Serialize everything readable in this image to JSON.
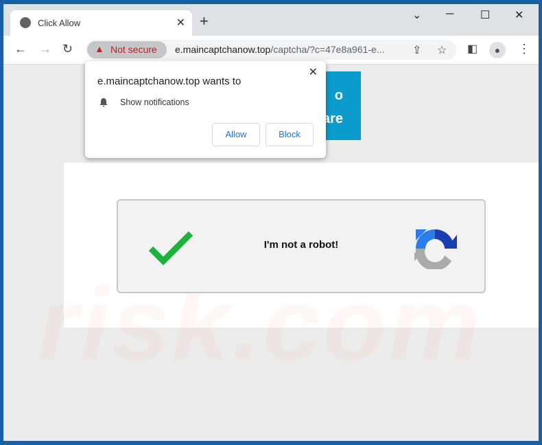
{
  "tab": {
    "title": "Click Allow",
    "icon": "globe-icon"
  },
  "window_controls": [
    "chevron-down-icon",
    "minimize-icon",
    "maximize-icon",
    "close-icon"
  ],
  "address_bar": {
    "security_label": "Not secure",
    "domain": "e.maincaptchanow.top",
    "path": "/captcha/?c=47e8a961-e..."
  },
  "page": {
    "blue_button_fragments": [
      "o",
      "are"
    ],
    "captcha_label": "I'm not a robot!",
    "watermark": "risk.com"
  },
  "popup": {
    "title": "e.maincaptchanow.top wants to",
    "permission": "Show notifications",
    "allow": "Allow",
    "block": "Block"
  },
  "colors": {
    "frame": "#1b5fa6",
    "warning": "#c5221f",
    "check": "#1db23b",
    "button_blue": "#1a73e8",
    "cta": "#0a9ccd"
  }
}
